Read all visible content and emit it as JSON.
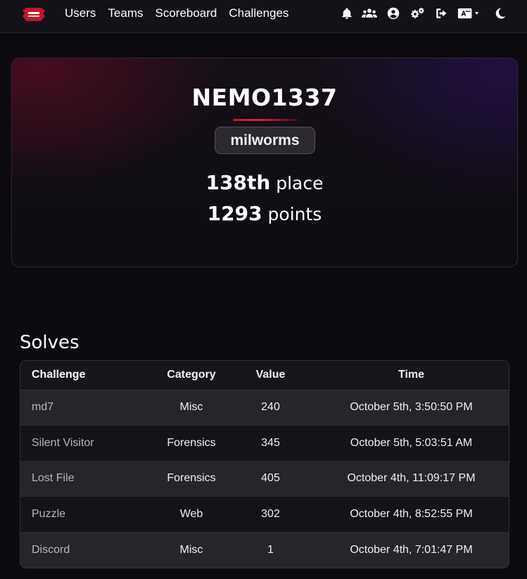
{
  "nav": {
    "links": [
      "Users",
      "Teams",
      "Scoreboard",
      "Challenges"
    ],
    "icons": [
      "bell-icon",
      "users-icon",
      "user-circle-icon",
      "cogs-icon",
      "logout-icon",
      "language-icon",
      "moon-icon"
    ]
  },
  "profile": {
    "username": "NEMO1337",
    "team": "milworms",
    "place_number": "138th",
    "place_label": "place",
    "points_number": "1293",
    "points_label": "points"
  },
  "solves": {
    "title": "Solves",
    "columns": [
      "Challenge",
      "Category",
      "Value",
      "Time"
    ],
    "rows": [
      {
        "challenge": "md7",
        "category": "Misc",
        "value": "240",
        "time": "October 5th, 3:50:50 PM"
      },
      {
        "challenge": "Silent Visitor",
        "category": "Forensics",
        "value": "345",
        "time": "October 5th, 5:03:51 AM"
      },
      {
        "challenge": "Lost File",
        "category": "Forensics",
        "value": "405",
        "time": "October 4th, 11:09:17 PM"
      },
      {
        "challenge": "Puzzle",
        "category": "Web",
        "value": "302",
        "time": "October 4th, 8:52:55 PM"
      },
      {
        "challenge": "Discord",
        "category": "Misc",
        "value": "1",
        "time": "October 4th, 7:01:47 PM"
      }
    ]
  },
  "colors": {
    "accent": "#c4142e",
    "background": "#0d0b10"
  }
}
